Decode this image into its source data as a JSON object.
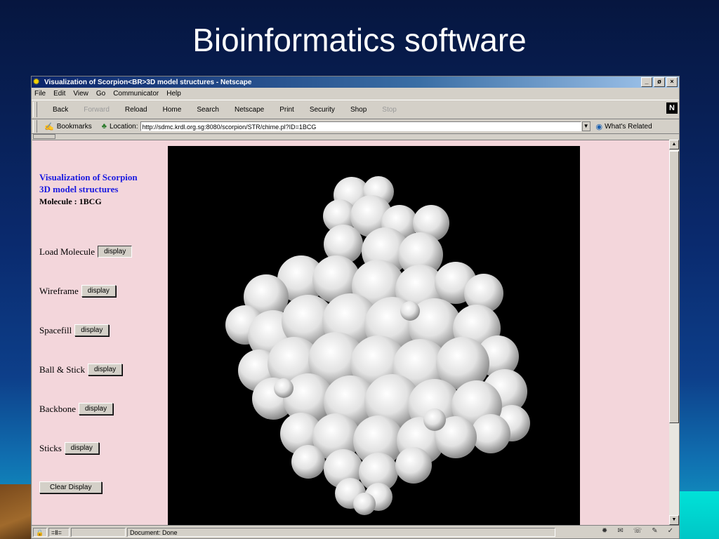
{
  "slide": {
    "title": "Bioinformatics software"
  },
  "window": {
    "title": "Visualization of Scorpion<BR>3D model structures - Netscape",
    "controls": [
      "_",
      "ø",
      "×"
    ],
    "menu": [
      "File",
      "Edit",
      "View",
      "Go",
      "Communicator",
      "Help"
    ],
    "toolbar": [
      {
        "label": "Back",
        "enabled": true
      },
      {
        "label": "Forward",
        "enabled": false
      },
      {
        "label": "Reload",
        "enabled": true
      },
      {
        "label": "Home",
        "enabled": true
      },
      {
        "label": "Search",
        "enabled": true
      },
      {
        "label": "Netscape",
        "enabled": true
      },
      {
        "label": "Print",
        "enabled": true
      },
      {
        "label": "Security",
        "enabled": true
      },
      {
        "label": "Shop",
        "enabled": true
      },
      {
        "label": "Stop",
        "enabled": false
      }
    ],
    "netscape_logo": "N",
    "location": {
      "bookmarks_label": "Bookmarks",
      "location_label": "Location:",
      "url": "http://sdmc.krdl.org.sg:8080/scorpion/STR/chime.pl?ID=1BCG",
      "related_label": "What's Related"
    }
  },
  "page": {
    "heading_line1": "Visualization of Scorpion",
    "heading_line2": "3D model structures",
    "molecule_label": "Molecule : 1BCG",
    "controls": [
      {
        "label": "Load Molecule",
        "button": "display"
      },
      {
        "label": "Wireframe",
        "button": "display"
      },
      {
        "label": "Spacefill",
        "button": "display"
      },
      {
        "label": "Ball & Stick",
        "button": "display"
      },
      {
        "label": "Backbone",
        "button": "display"
      },
      {
        "label": "Sticks",
        "button": "display"
      }
    ],
    "clear_button": "Clear Display"
  },
  "status": {
    "text": "Document: Done"
  },
  "colors": {
    "slide_bg": "#0a2a6e",
    "page_bg": "#f3d6db",
    "heading": "#1a1ae0",
    "viewer_bg": "#000000"
  }
}
